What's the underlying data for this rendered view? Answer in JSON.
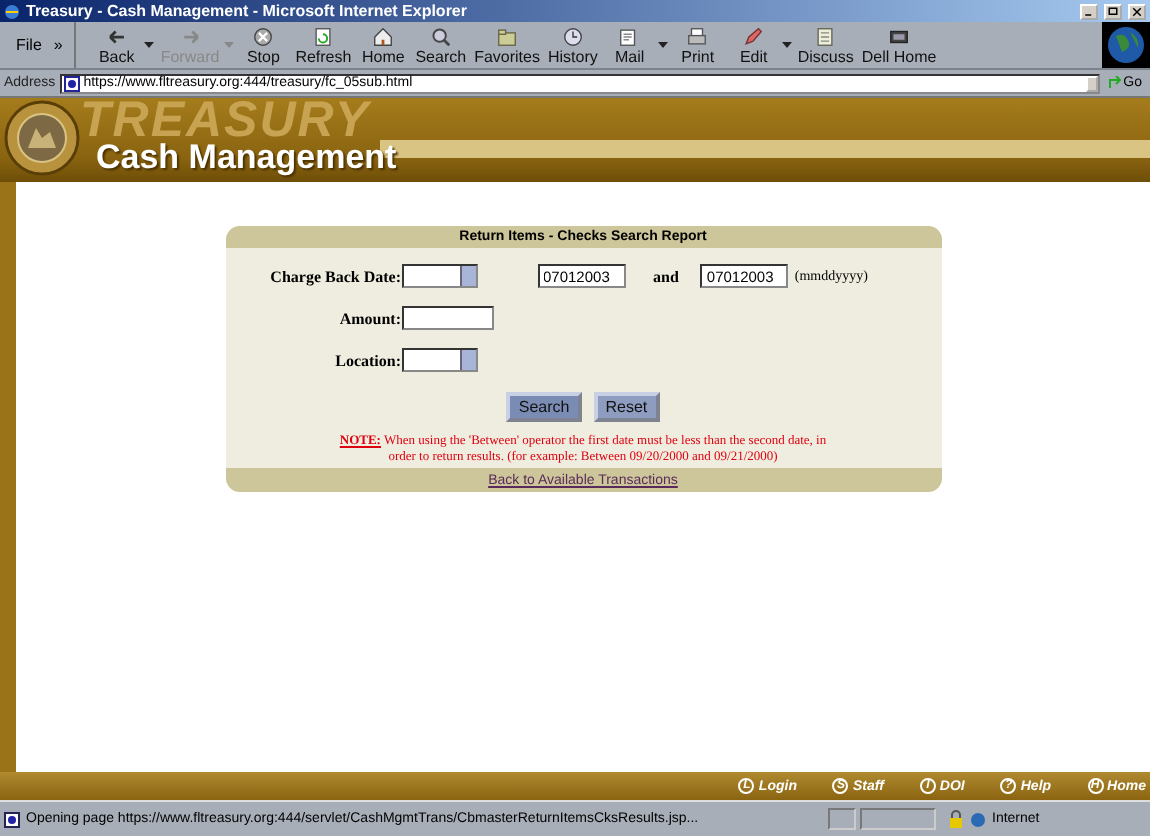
{
  "window": {
    "title": "Treasury - Cash Management - Microsoft Internet Explorer"
  },
  "menu": {
    "label": "File",
    "more": "»"
  },
  "toolbar": [
    {
      "label": "Back",
      "kind": "back",
      "disabled": false,
      "dropdown": true
    },
    {
      "label": "Forward",
      "kind": "forward",
      "disabled": true,
      "dropdown": true
    },
    {
      "label": "Stop",
      "kind": "stop",
      "disabled": false,
      "dropdown": false
    },
    {
      "label": "Refresh",
      "kind": "refresh",
      "disabled": false,
      "dropdown": false
    },
    {
      "label": "Home",
      "kind": "home",
      "disabled": false,
      "dropdown": false
    },
    {
      "label": "Search",
      "kind": "search",
      "disabled": false,
      "dropdown": false
    },
    {
      "label": "Favorites",
      "kind": "favorites",
      "disabled": false,
      "dropdown": false
    },
    {
      "label": "History",
      "kind": "history",
      "disabled": false,
      "dropdown": false
    },
    {
      "label": "Mail",
      "kind": "mail",
      "disabled": false,
      "dropdown": true
    },
    {
      "label": "Print",
      "kind": "print",
      "disabled": false,
      "dropdown": false
    },
    {
      "label": "Edit",
      "kind": "edit",
      "disabled": false,
      "dropdown": true
    },
    {
      "label": "Discuss",
      "kind": "discuss",
      "disabled": false,
      "dropdown": false
    },
    {
      "label": "Dell Home",
      "kind": "dell",
      "disabled": false,
      "dropdown": false
    }
  ],
  "address": {
    "label": "Address",
    "value": "https://www.fltreasury.org:444/treasury/fc_05sub.html",
    "go": "Go"
  },
  "banner": {
    "backdrop": "TREASURY",
    "title": "Cash Management"
  },
  "form": {
    "title": "Return Items - Checks Search Report",
    "charge_back_date": {
      "label": "Charge Back Date:",
      "from": "07012003",
      "joiner": "and",
      "to": "07012003",
      "format": "(mmddyyyy)"
    },
    "amount": {
      "label": "Amount:"
    },
    "location": {
      "label": "Location:"
    },
    "buttons": [
      "Search",
      "Reset"
    ],
    "note": "**NOTE:** When using the 'Between' operator the first date must be less than the second date, in order to return results. (for example: Between 09/20/2000 and 09/21/2000)",
    "back_link": "Back to Available Transactions"
  },
  "footer_links": [
    {
      "badge": "L",
      "label": "Login"
    },
    {
      "badge": "S",
      "label": "Staff"
    },
    {
      "badge": "I",
      "label": "DOI"
    },
    {
      "badge": "?",
      "label": "Help"
    },
    {
      "badge": "H",
      "label": "Home"
    }
  ],
  "status_bar": {
    "text": "Opening page https://www.fltreasury.org:444/servlet/CashMgmtTrans/CbmasterReturnItemsCksResults.jsp...",
    "zone": "Internet"
  }
}
